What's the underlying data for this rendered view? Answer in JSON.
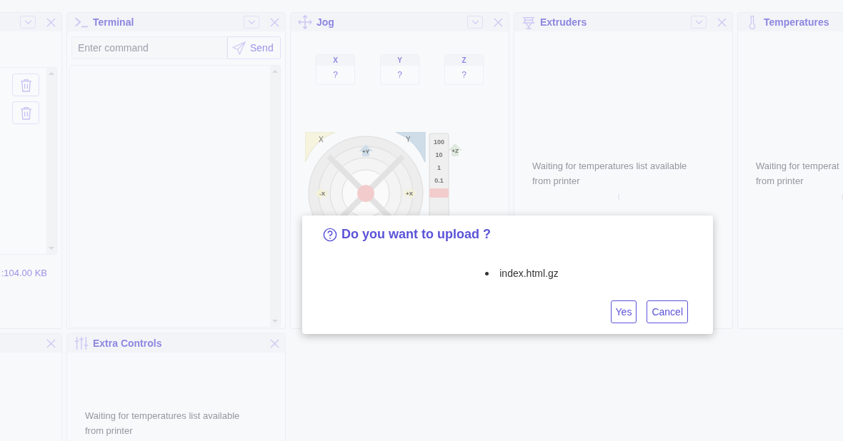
{
  "panels_top": [
    {
      "kind": "files",
      "collapsible": true,
      "closable": true,
      "rows": [
        {
          "kind": "delete"
        },
        {
          "kind": "delete"
        }
      ],
      "size_text": ":104.00 KB"
    },
    {
      "kind": "terminal",
      "title": "Terminal",
      "collapsible": true,
      "closable": true,
      "placeholder": "Enter command",
      "send_label": "Send"
    },
    {
      "kind": "jog",
      "title": "Jog",
      "collapsible": true,
      "closable": true,
      "axes": [
        {
          "label": "X",
          "value": "?"
        },
        {
          "label": "Y",
          "value": "?"
        },
        {
          "label": "Z",
          "value": "?"
        }
      ],
      "home_labels": [
        "X",
        "Y"
      ],
      "arrows": [
        "+Y",
        "-X",
        "+X",
        "+Z"
      ],
      "steps": [
        "100",
        "10",
        "1",
        "0.1"
      ]
    },
    {
      "kind": "extruders",
      "title": "Extruders",
      "collapsible": true,
      "closable": true,
      "message": [
        "Waiting for temperatures list available",
        "from printer"
      ],
      "spinner": true
    },
    {
      "kind": "temperatures",
      "title": "Temperatures",
      "collapsible": false,
      "closable": false,
      "message": [
        "Waiting for temperat",
        "from printer"
      ],
      "spinner": true
    }
  ],
  "panels_bottom": [
    {
      "kind": "blank",
      "collapsible": false,
      "closable": true
    },
    {
      "kind": "extra_controls",
      "title": "Extra Controls",
      "collapsible": false,
      "closable": true,
      "message": [
        "Waiting for temperatures list available",
        "from printer"
      ],
      "spinner": false
    }
  ],
  "dialog": {
    "title": "Do you want to upload ?",
    "files": [
      "index.html.gz"
    ],
    "buttons": [
      {
        "label": "Yes"
      },
      {
        "label": "Cancel"
      }
    ]
  }
}
